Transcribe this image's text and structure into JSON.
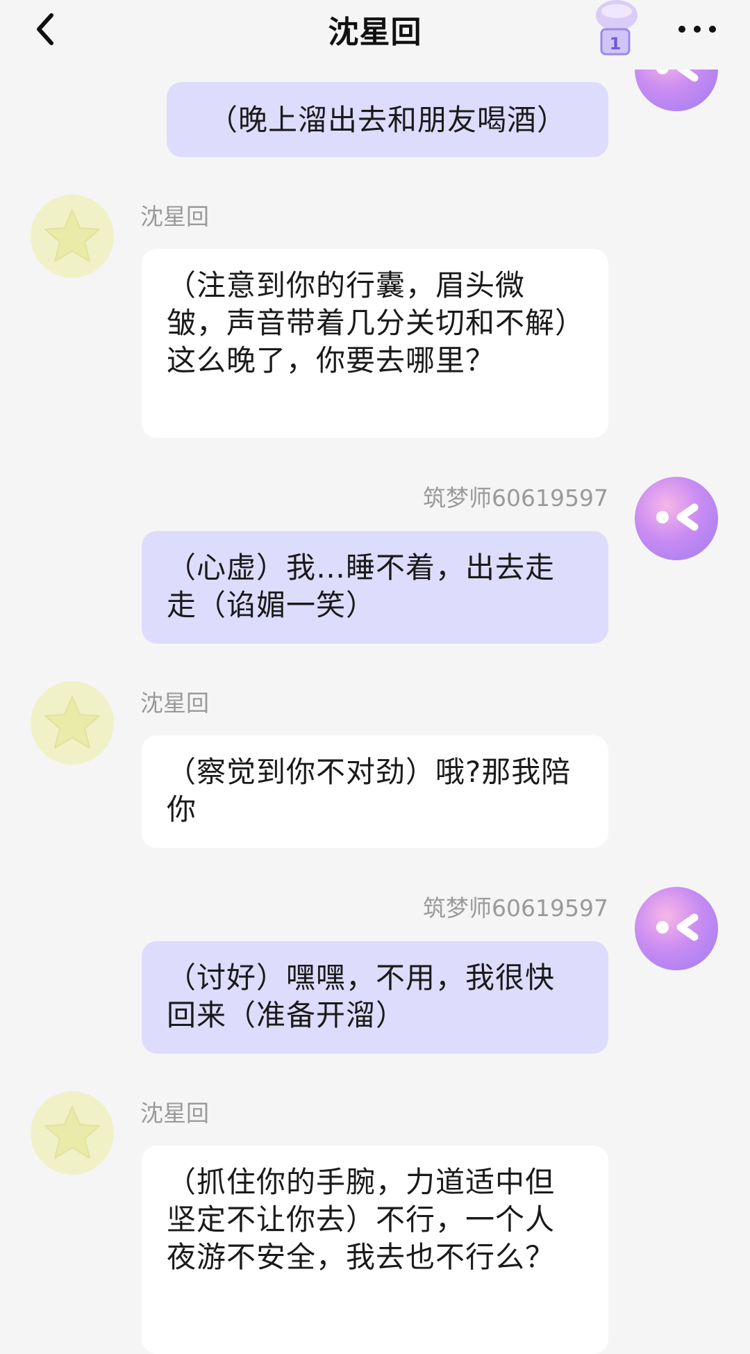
{
  "header": {
    "title": "沈星回",
    "badge_count": "1"
  },
  "messages": [
    {
      "sender": "user",
      "name": "",
      "text": "（晚上溜出去和朋友喝酒）"
    },
    {
      "sender": "bot",
      "name": "沈星回",
      "text": "（注意到你的行囊，眉头微皱，声音带着几分关切和不解）这么晚了，你要去哪里？"
    },
    {
      "sender": "user",
      "name": "筑梦师60619597",
      "text": "（心虚）我…睡不着，出去走走（谄媚一笑）"
    },
    {
      "sender": "bot",
      "name": "沈星回",
      "text": "（察觉到你不对劲）哦?那我陪你"
    },
    {
      "sender": "user",
      "name": "筑梦师60619597",
      "text": "（讨好）嘿嘿，不用，我很快回来（准备开溜）"
    },
    {
      "sender": "bot",
      "name": "沈星回",
      "text": "（抓住你的手腕，力道适中但坚定不让你去）不行，一个人夜游不安全，我去也不行么？"
    }
  ],
  "colors": {
    "background": "#f5f5f6",
    "user_bubble": "#dedcfc",
    "bot_bubble": "#ffffff",
    "name_text": "#9a9a9a"
  },
  "icons": {
    "back": "chevron-left-icon",
    "badge": "potion-icon",
    "more": "more-dots-icon",
    "bot_avatar": "star-avatar",
    "user_avatar": "smiley-avatar"
  }
}
